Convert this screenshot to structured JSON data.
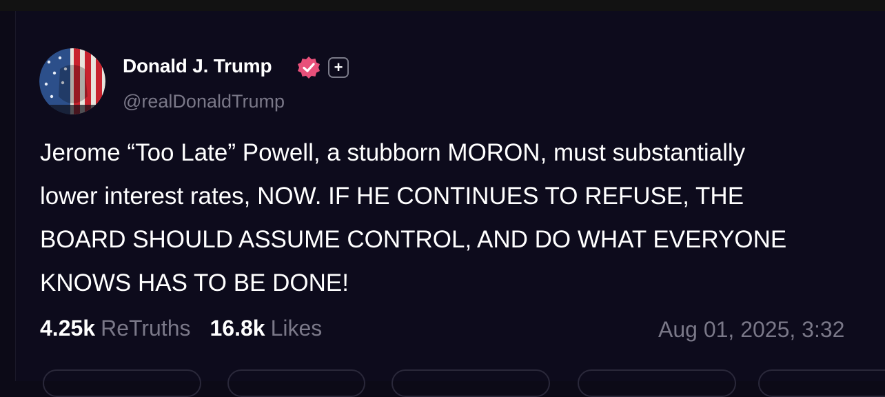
{
  "post": {
    "author_name": "Donald J. Trump",
    "handle": "@realDonaldTrump",
    "plus_badge": "+",
    "verified_icon": "verified-badge-icon",
    "text": "Jerome “Too Late” Powell, a stubborn MORON, must substantially\nlower interest rates, NOW. IF HE CONTINUES TO REFUSE, THE\nBOARD SHOULD ASSUME CONTROL, AND DO WHAT EVERYONE\nKNOWS HAS TO BE DONE!",
    "stats": {
      "retruths_count": "4.25k",
      "retruths_label": "ReTruths",
      "likes_count": "16.8k",
      "likes_label": "Likes"
    },
    "timestamp": "Aug 01, 2025, 3:32"
  },
  "colors": {
    "background": "#0d0b1c",
    "verified_badge": "#e8507a",
    "muted_text": "#7a7888",
    "primary_text": "#ffffff"
  }
}
